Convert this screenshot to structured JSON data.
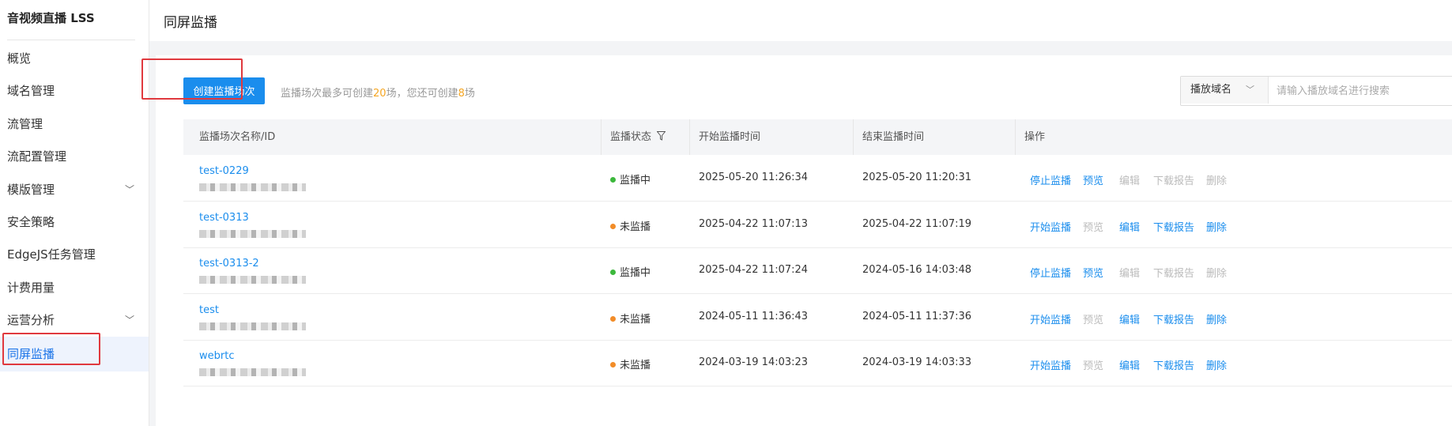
{
  "app": {
    "brand": "音视频直播 LSS"
  },
  "sidebar": {
    "items": [
      {
        "label": "概览",
        "chevron": false,
        "active": false
      },
      {
        "label": "域名管理",
        "chevron": false,
        "active": false
      },
      {
        "label": "流管理",
        "chevron": false,
        "active": false
      },
      {
        "label": "流配置管理",
        "chevron": false,
        "active": false
      },
      {
        "label": "模版管理",
        "chevron": true,
        "active": false
      },
      {
        "label": "安全策略",
        "chevron": false,
        "active": false
      },
      {
        "label": "EdgeJS任务管理",
        "chevron": false,
        "active": false
      },
      {
        "label": "计费用量",
        "chevron": false,
        "active": false
      },
      {
        "label": "运营分析",
        "chevron": true,
        "active": false
      },
      {
        "label": "同屏监播",
        "chevron": false,
        "active": true
      }
    ]
  },
  "header": {
    "title": "同屏监播"
  },
  "toolbar": {
    "create_label": "创建监播场次",
    "quota_prefix": "监播场次最多可创建",
    "quota_max": "20",
    "quota_mid": "场，您还可创建",
    "quota_left": "8",
    "quota_suffix": "场"
  },
  "search": {
    "select_value": "播放域名",
    "placeholder": "请输入播放域名进行搜索",
    "icon": "search-icon"
  },
  "table": {
    "headers": {
      "name": "监播场次名称/ID",
      "status": "监播状态",
      "start": "开始监播时间",
      "end": "结束监播时间",
      "ops": "操作"
    },
    "rows": [
      {
        "name": "test-0229",
        "status": "监播中",
        "status_color": "#3cb83c",
        "start": "2025-05-20 11:26:34",
        "end": "2025-05-20 11:20:31",
        "actions": [
          {
            "label": "停止监播",
            "enabled": true
          },
          {
            "label": "预览",
            "enabled": true
          },
          {
            "label": "编辑",
            "enabled": false
          },
          {
            "label": "下载报告",
            "enabled": false
          },
          {
            "label": "删除",
            "enabled": false
          }
        ]
      },
      {
        "name": "test-0313",
        "status": "未监播",
        "status_color": "#f28c28",
        "start": "2025-04-22 11:07:13",
        "end": "2025-04-22 11:07:19",
        "actions": [
          {
            "label": "开始监播",
            "enabled": true
          },
          {
            "label": "预览",
            "enabled": false
          },
          {
            "label": "编辑",
            "enabled": true
          },
          {
            "label": "下载报告",
            "enabled": true
          },
          {
            "label": "删除",
            "enabled": true
          }
        ]
      },
      {
        "name": "test-0313-2",
        "status": "监播中",
        "status_color": "#3cb83c",
        "start": "2025-04-22 11:07:24",
        "end": "2024-05-16 14:03:48",
        "actions": [
          {
            "label": "停止监播",
            "enabled": true
          },
          {
            "label": "预览",
            "enabled": true
          },
          {
            "label": "编辑",
            "enabled": false
          },
          {
            "label": "下载报告",
            "enabled": false
          },
          {
            "label": "删除",
            "enabled": false
          }
        ]
      },
      {
        "name": "test",
        "status": "未监播",
        "status_color": "#f28c28",
        "start": "2024-05-11 11:36:43",
        "end": "2024-05-11 11:37:36",
        "actions": [
          {
            "label": "开始监播",
            "enabled": true
          },
          {
            "label": "预览",
            "enabled": false
          },
          {
            "label": "编辑",
            "enabled": true
          },
          {
            "label": "下载报告",
            "enabled": true
          },
          {
            "label": "删除",
            "enabled": true
          }
        ]
      },
      {
        "name": "webrtc",
        "status": "未监播",
        "status_color": "#f28c28",
        "start": "2024-03-19 14:03:23",
        "end": "2024-03-19 14:03:33",
        "actions": [
          {
            "label": "开始监播",
            "enabled": true
          },
          {
            "label": "预览",
            "enabled": false
          },
          {
            "label": "编辑",
            "enabled": true
          },
          {
            "label": "下载报告",
            "enabled": true
          },
          {
            "label": "删除",
            "enabled": true
          }
        ]
      }
    ]
  }
}
